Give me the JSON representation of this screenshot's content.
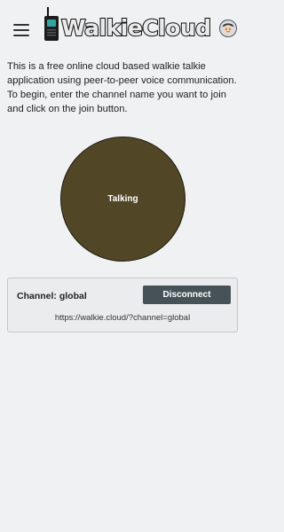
{
  "app": {
    "title": "WalkieCloud"
  },
  "header": {
    "menu_icon": "hamburger-menu-icon",
    "logo_icon": "walkie-talkie-icon",
    "avatar_icon": "user-avatar-icon"
  },
  "intro": {
    "text": "This is a free online cloud based walkie talkie application using peer-to-peer voice communication. To begin, enter the channel name you want to join and click on the join button."
  },
  "talk_button": {
    "label": "Talking",
    "color": "#514726"
  },
  "channel": {
    "label": "Channel: global",
    "disconnect_label": "Disconnect",
    "url": "https://walkie.cloud/?channel=global"
  },
  "colors": {
    "background": "#f0f1f3",
    "disconnect_button": "#475257",
    "card_background": "#ebecee"
  }
}
